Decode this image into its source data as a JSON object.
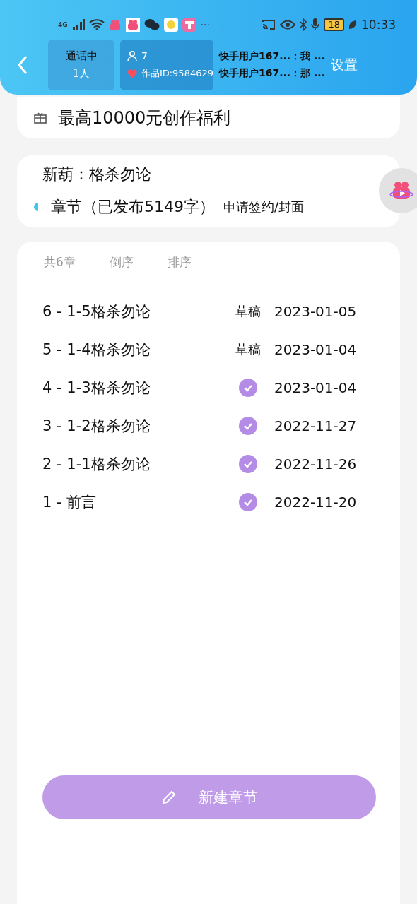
{
  "status_bar": {
    "network": "4G",
    "more": "···",
    "battery": "18",
    "time": "10:33"
  },
  "live_bar": {
    "call_status": "通话中",
    "call_people": "1人",
    "viewers": "7",
    "work_id": "作品ID:9584629",
    "messages": [
      "快手用户167...：我 ...",
      "快手用户167...：那 ..."
    ],
    "settings": "设置"
  },
  "banner": {
    "text": "最高10000元创作福利"
  },
  "book": {
    "title": "新葫：格杀勿论",
    "chapters_label": "章节（已发布5149字）",
    "apply_link": "申请签约/封面"
  },
  "chapter_list": {
    "count": "共6章",
    "reverse": "倒序",
    "sort": "排序",
    "rows": [
      {
        "title": "6 - 1-5格杀勿论",
        "published": false,
        "status_label": "草稿",
        "date": "2023-01-05"
      },
      {
        "title": "5 - 1-4格杀勿论",
        "published": false,
        "status_label": "草稿",
        "date": "2023-01-04"
      },
      {
        "title": "4 - 1-3格杀勿论",
        "published": true,
        "date": "2023-01-04"
      },
      {
        "title": "3 - 1-2格杀勿论",
        "published": true,
        "date": "2022-11-27"
      },
      {
        "title": "2 - 1-1格杀勿论",
        "published": true,
        "date": "2022-11-26"
      },
      {
        "title": "1 - 前言",
        "published": true,
        "date": "2022-11-20"
      }
    ]
  },
  "new_chapter_button": {
    "label": "新建章节"
  }
}
